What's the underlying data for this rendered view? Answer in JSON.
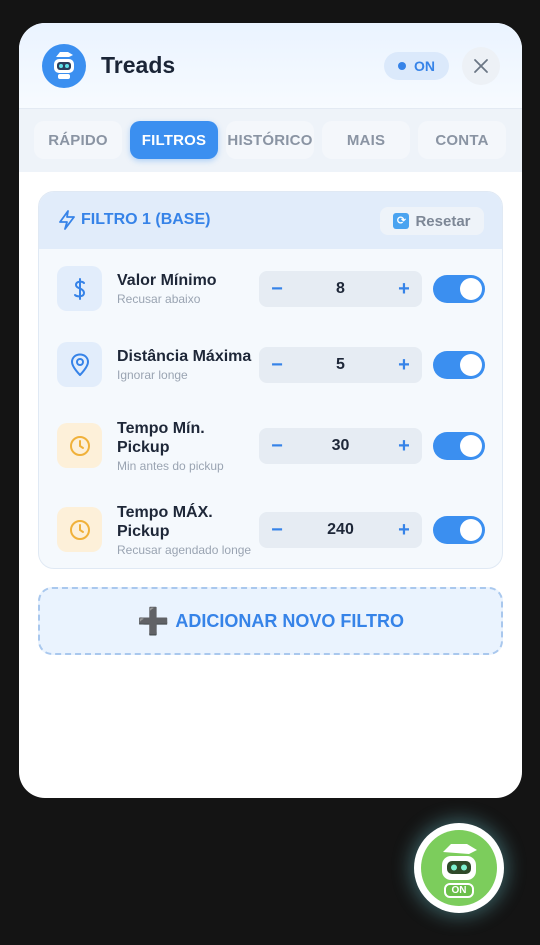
{
  "app": {
    "title": "Treads",
    "status_badge": "ON"
  },
  "tabs": [
    {
      "label": "RÁPIDO",
      "active": false
    },
    {
      "label": "FILTROS",
      "active": true
    },
    {
      "label": "HISTÓRICO",
      "active": false
    },
    {
      "label": "MAIS",
      "active": false
    },
    {
      "label": "CONTA",
      "active": false
    }
  ],
  "filter_card": {
    "title": "FILTRO 1 (BASE)",
    "reset_label": "Resetar",
    "rows": [
      {
        "label": "Valor Mínimo",
        "sub": "Recusar abaixo",
        "value": "8",
        "enabled": true,
        "icon": "dollar-icon"
      },
      {
        "label": "Distância Máxima",
        "sub": "Ignorar longe",
        "value": "5",
        "enabled": true,
        "icon": "location-pin-icon"
      },
      {
        "label": "Tempo Mín. Pickup",
        "sub": "Min antes do pickup",
        "value": "30",
        "enabled": true,
        "icon": "clock-icon"
      },
      {
        "label": "Tempo MÁX. Pickup",
        "sub": "Recusar agendado longe",
        "value": "240",
        "enabled": true,
        "icon": "clock-icon"
      }
    ],
    "minus_symbol": "−",
    "plus_symbol": "+"
  },
  "add_filter": {
    "plus_symbol": "➕",
    "label": "ADICIONAR NOVO FILTRO"
  },
  "fab": {
    "badge": "ON"
  },
  "colors": {
    "accent": "#3b8ff0",
    "fab_green": "#7ccd5c",
    "amber": "#f0b13a"
  }
}
